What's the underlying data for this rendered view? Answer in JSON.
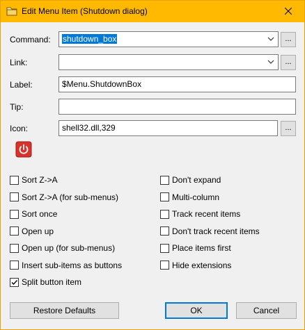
{
  "window": {
    "title": "Edit Menu Item (Shutdown dialog)",
    "accent_color": "#ffb900",
    "close_icon": "close-icon",
    "app_icon": "folder-icon"
  },
  "fields": {
    "command": {
      "label": "Command:",
      "value": "shutdown_box",
      "selected": true
    },
    "link": {
      "label": "Link:",
      "value": ""
    },
    "label": {
      "label": "Label:",
      "value": "$Menu.ShutdownBox"
    },
    "tip": {
      "label": "Tip:",
      "value": ""
    },
    "icon": {
      "label": "Icon:",
      "value": "shell32.dll,329"
    },
    "browse_label": "...",
    "icon_preview": "power-icon",
    "icon_preview_color": "#d8322c"
  },
  "options_left": [
    {
      "label": "Sort Z->A",
      "checked": false
    },
    {
      "label": "Sort Z->A (for sub-menus)",
      "checked": false
    },
    {
      "label": "Sort once",
      "checked": false
    },
    {
      "label": "Open up",
      "checked": false
    },
    {
      "label": "Open up (for sub-menus)",
      "checked": false
    },
    {
      "label": "Insert sub-items as buttons",
      "checked": false
    },
    {
      "label": "Split button item",
      "checked": true
    }
  ],
  "options_right": [
    {
      "label": "Don't expand",
      "checked": false
    },
    {
      "label": "Multi-column",
      "checked": false
    },
    {
      "label": "Track recent items",
      "checked": false
    },
    {
      "label": "Don't track recent items",
      "checked": false
    },
    {
      "label": "Place items first",
      "checked": false
    },
    {
      "label": "Hide extensions",
      "checked": false
    }
  ],
  "buttons": {
    "restore_defaults": "Restore Defaults",
    "ok": "OK",
    "cancel": "Cancel"
  }
}
